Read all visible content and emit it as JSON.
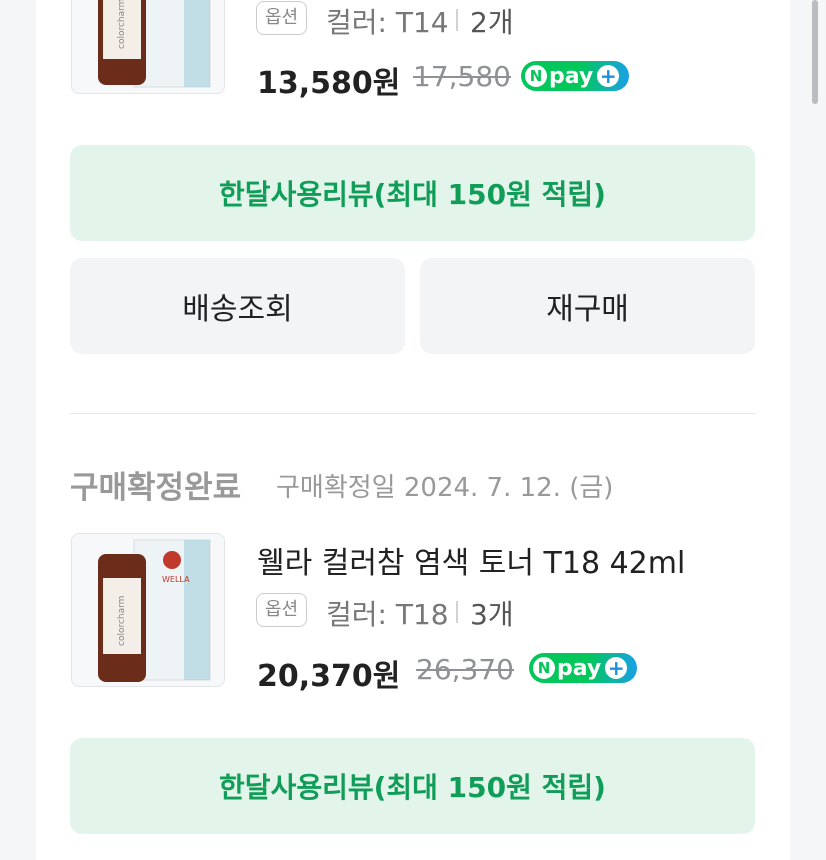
{
  "orders": [
    {
      "product_name": "",
      "option_badge": "옵션",
      "option_text": "컬러: T14",
      "quantity": "2개",
      "price": "13,580원",
      "original_price": "17,580",
      "npay_label": "pay",
      "review_button": "한달사용리뷰(최대 150원 적립)",
      "delivery_button": "배송조회",
      "rebuy_button": "재구매"
    },
    {
      "status": "구매확정완료",
      "status_date": "구매확정일 2024. 7. 12. (금)",
      "product_name": "웰라 컬러참 염색 토너 T18 42ml",
      "option_badge": "옵션",
      "option_text": "컬러: T18",
      "quantity": "3개",
      "price": "20,370원",
      "original_price": "26,370",
      "npay_label": "pay",
      "review_button": "한달사용리뷰(최대 150원 적립)"
    }
  ],
  "product_image": {
    "brand": "WELLA",
    "line": "colorcharm",
    "colors": {
      "bottle": "#6b2c1a",
      "box": "#eef3f6",
      "accent": "#9ccbd8"
    }
  },
  "npay_icon": "N",
  "npay_plus_icon": "+",
  "accent_color": "#0f9d58"
}
